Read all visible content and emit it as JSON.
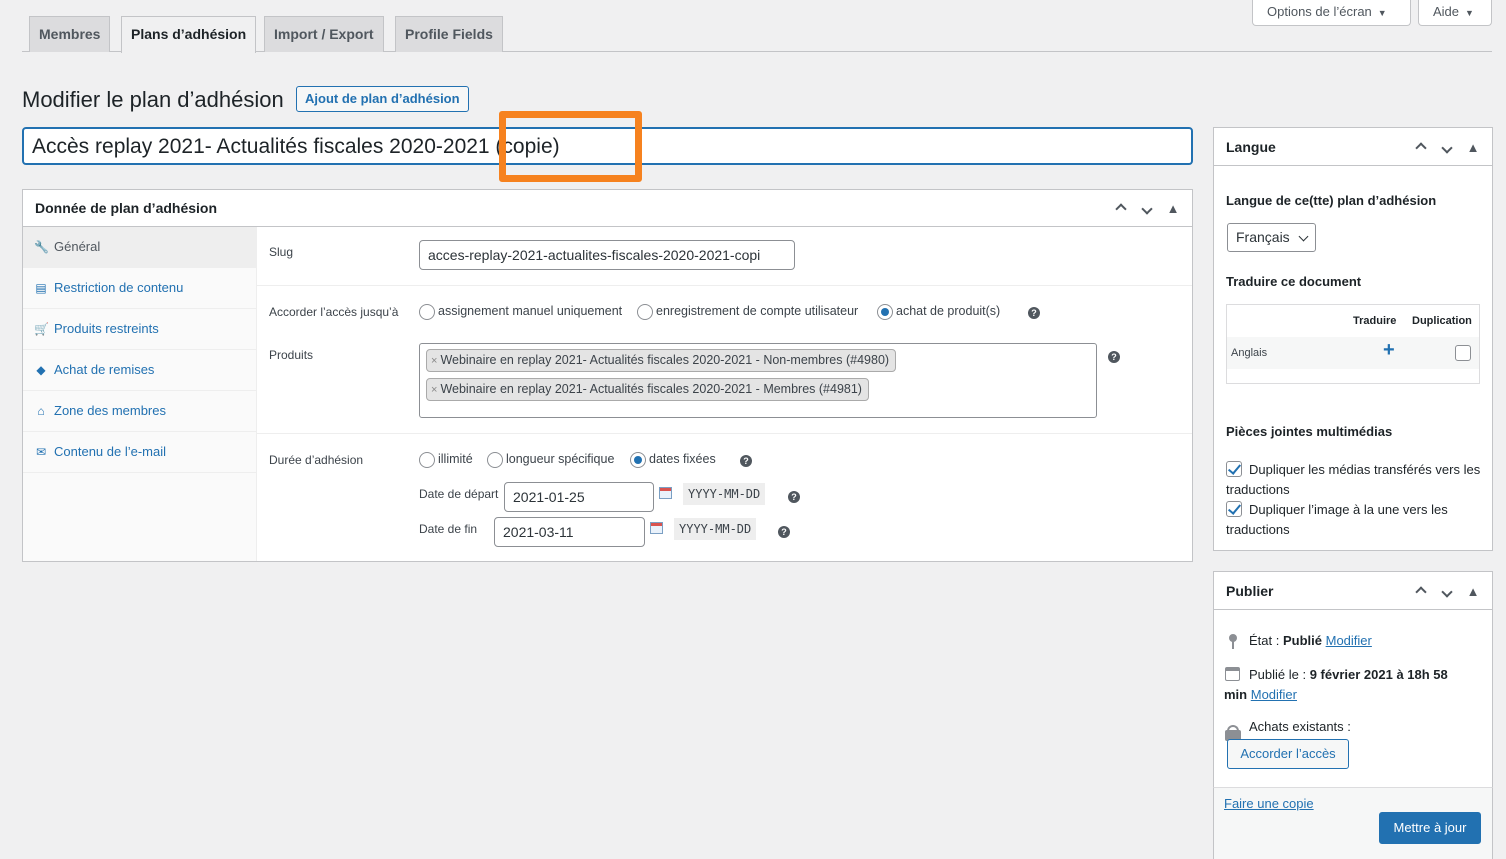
{
  "screen_options": {
    "options_label": "Options de l’écran",
    "help_label": "Aide"
  },
  "tabs": [
    {
      "label": "Membres"
    },
    {
      "label": "Plans d’adhésion"
    },
    {
      "label": "Import / Export"
    },
    {
      "label": "Profile Fields"
    }
  ],
  "header": {
    "title": "Modifier le plan d’adhésion",
    "add_button": "Ajout de plan d’adhésion"
  },
  "post_title": {
    "value": "Accès replay 2021- Actualités fiscales 2020-2021 (copie)"
  },
  "plan_data": {
    "title": "Donnée de plan d’adhésion",
    "nav": [
      {
        "label": "Général",
        "icon": "wrench-icon"
      },
      {
        "label": "Restriction de contenu",
        "icon": "document-icon"
      },
      {
        "label": "Produits restreints",
        "icon": "cart-icon"
      },
      {
        "label": "Achat de remises",
        "icon": "tag-icon"
      },
      {
        "label": "Zone des membres",
        "icon": "house-icon"
      },
      {
        "label": "Contenu de l’e-mail",
        "icon": "email-icon"
      }
    ],
    "slug_label": "Slug",
    "slug_value": "acces-replay-2021-actualites-fiscales-2020-2021-copi",
    "access_label": "Accorder l’accès jusqu’à",
    "access_options": [
      "assignement manuel uniquement",
      "enregistrement de compte utilisateur",
      "achat de produit(s)"
    ],
    "access_selected": "achat de produit(s)",
    "products_label": "Produits",
    "products": [
      "Webinaire en replay 2021- Actualités fiscales 2020-2021 - Non-membres (#4980)",
      "Webinaire en replay 2021- Actualités fiscales 2020-2021 - Membres (#4981)"
    ],
    "duration_label": "Durée d’adhésion",
    "duration_options": [
      "illimité",
      "longueur spécifique",
      "dates fixées"
    ],
    "duration_selected": "dates fixées",
    "start_label": "Date de départ",
    "start_value": "2021-01-25",
    "end_label": "Date de fin",
    "end_value": "2021-03-11",
    "date_format": "YYYY-MM-DD"
  },
  "language_box": {
    "title": "Langue",
    "lang_of_label": "Langue de ce(tte) plan d’adhésion",
    "selected_language": "Français",
    "translate_label": "Traduire ce document",
    "col_translate": "Traduire",
    "col_duplicate": "Duplication",
    "row_language": "Anglais",
    "media_label": "Pièces jointes multimédias",
    "media_options": [
      {
        "label": "Dupliquer les médias transférés vers les traductions",
        "checked": true
      },
      {
        "label": "Dupliquer l’image à la une vers les traductions",
        "checked": true
      }
    ]
  },
  "publish_box": {
    "title": "Publier",
    "state_label": "État :",
    "state_value": "Publié",
    "modify": "Modifier",
    "published_label": "Publié le :",
    "published_value": "9 février 2021 à 18h 58",
    "published_suffix": "min",
    "purchases_label": "Achats existants :",
    "grant_button": "Accorder l’accès",
    "copy_link": "Faire une copie",
    "update_button": "Mettre à jour"
  },
  "colors": {
    "accent": "#2271b1",
    "highlight": "#f6821f"
  }
}
